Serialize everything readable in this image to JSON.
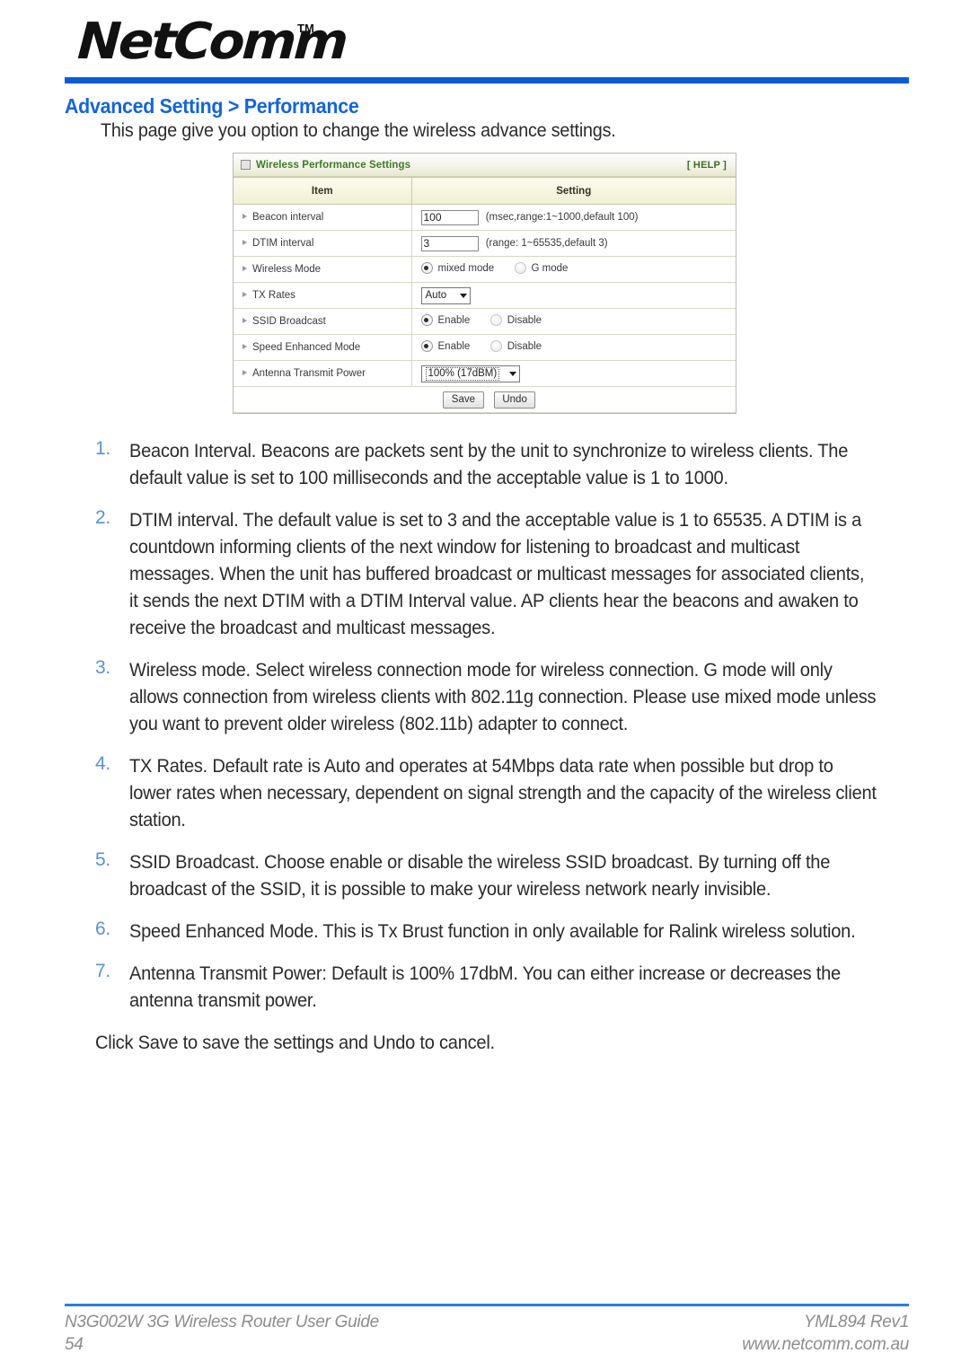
{
  "brand": {
    "logo_wordmark": "NetComm",
    "trademark": "TM"
  },
  "heading": {
    "title": "Advanced Setting > Performance",
    "intro": "This page give you option to change the wireless advance settings."
  },
  "panel": {
    "window_icon": "window-icon",
    "title": "Wireless Performance Settings",
    "help_label": "[ HELP ]",
    "columns": {
      "item": "Item",
      "setting": "Setting"
    },
    "rows": [
      {
        "label": "Beacon interval",
        "type": "text",
        "value": "100",
        "hint": "(msec,range:1~1000,default 100)"
      },
      {
        "label": "DTIM interval",
        "type": "text",
        "value": "3",
        "hint": "(range: 1~65535,default 3)"
      },
      {
        "label": "Wireless Mode",
        "type": "radio",
        "options": [
          "mixed mode",
          "G mode"
        ],
        "selected": "mixed mode"
      },
      {
        "label": "TX Rates",
        "type": "select",
        "value": "Auto"
      },
      {
        "label": "SSID Broadcast",
        "type": "radio",
        "options": [
          "Enable",
          "Disable"
        ],
        "selected": "Enable"
      },
      {
        "label": "Speed Enhanced Mode",
        "type": "radio",
        "options": [
          "Enable",
          "Disable"
        ],
        "selected": "Enable"
      },
      {
        "label": "Antenna Transmit Power",
        "type": "select",
        "value": "100% (17dBM)"
      }
    ],
    "buttons": {
      "save": "Save",
      "undo": "Undo"
    }
  },
  "notes": [
    {
      "num": "1.",
      "text": "Beacon Interval. Beacons are packets sent by the unit to synchronize to wireless clients. The default value is set to 100 milliseconds and the acceptable value is 1 to 1000."
    },
    {
      "num": "2.",
      "text": "DTIM interval. The default value is set to 3 and the acceptable value is 1 to 65535. A DTIM is a countdown informing clients of the next window for listening to broadcast and multicast messages. When the unit has buffered broadcast or multicast messages for associated clients, it sends the next DTIM with a DTIM Interval value. AP clients hear the beacons and awaken to receive the broadcast and multicast messages."
    },
    {
      "num": "3.",
      "text": "Wireless mode. Select wireless connection mode for wireless connection. G mode will only allows connection from wireless clients with 802.11g connection. Please use mixed mode unless you want to prevent older wireless (802.11b) adapter to connect."
    },
    {
      "num": "4.",
      "text": "TX Rates. Default rate is Auto and operates at 54Mbps data rate when possible but drop to lower rates when necessary, dependent on signal strength and the capacity of the wireless client station."
    },
    {
      "num": "5.",
      "text": "SSID Broadcast. Choose enable or disable the wireless SSID broadcast. By turning off the broadcast of the SSID, it is possible to make your wireless network nearly invisible."
    },
    {
      "num": "6.",
      "text": "Speed Enhanced Mode. This is Tx Brust function in only available for Ralink wireless solution."
    },
    {
      "num": "7.",
      "text": "Antenna Transmit Power: Default is 100% 17dbM. You can either increase or decreases the antenna transmit power."
    }
  ],
  "closing_line": "Click Save to save the settings and Undo to cancel.",
  "footer": {
    "left_top": "N3G002W 3G Wireless Router User Guide",
    "left_bottom": "54",
    "right_top": "YML894 Rev1",
    "right_bottom": "www.netcomm.com.au"
  },
  "colors": {
    "accent_blue": "#0a5ed2",
    "heading_blue": "#1565d8",
    "list_number_blue": "#5a90d8",
    "panel_title_green": "#3f7a28",
    "footer_gray": "#8d8d8d"
  }
}
